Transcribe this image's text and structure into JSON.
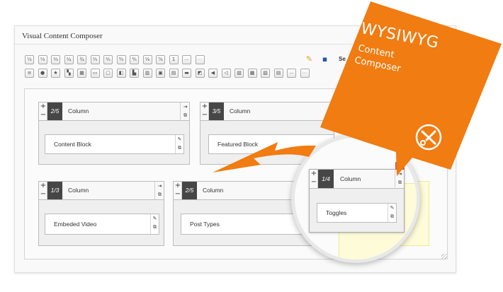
{
  "panel": {
    "title": "Visual Content Composer"
  },
  "toolbar": {
    "row1_icons": [
      "column-1-2-icon",
      "column-1-3-icon",
      "column-2-3-icon",
      "column-1-4-icon",
      "column-3-4-icon",
      "column-1-5-icon",
      "column-2-5-icon",
      "column-3-5-icon",
      "column-4-5-icon",
      "column-1-6-icon",
      "column-5-6-icon",
      "column-full-icon",
      "dash-icon",
      "dots-icon"
    ],
    "row1_glyphs": [
      "½",
      "⅓",
      "⅔",
      "¼",
      "¾",
      "⅕",
      "⅖",
      "⅗",
      "⅘",
      "⅙",
      "⅚",
      "1",
      "—",
      "⋯"
    ],
    "row2_icons": [
      "list-icon",
      "circle-icon",
      "star-icon",
      "layers-icon",
      "image-block-icon",
      "table-icon",
      "window-icon",
      "split-icon",
      "chart-icon",
      "building-icon",
      "photo-icon",
      "slider-icon",
      "monitor-icon",
      "video-icon",
      "audio-icon",
      "audio-play-icon",
      "gallery-icon",
      "grid-icon",
      "contact-form-icon",
      "form-icon",
      "dash-icon",
      "dots-icon"
    ],
    "row2_glyphs": [
      "≡",
      "●",
      "★",
      "▚",
      "▦",
      "▭",
      "▢",
      "◧",
      "▙",
      "▥",
      "▣",
      "▤",
      "▬",
      "◩",
      "◀",
      "◁",
      "▧",
      "▩",
      "▨",
      "▤",
      "—",
      "⋯"
    ],
    "save_label": "Se",
    "clean_glyph": "✎",
    "save_glyph": "▪"
  },
  "columns": [
    {
      "size": "2/5",
      "title": "Column",
      "block": "Content Block"
    },
    {
      "size": "3/5",
      "title": "Column",
      "block": "Featured Block"
    },
    {
      "size": "1/3",
      "title": "Column",
      "block": "Embeded Video"
    },
    {
      "size": "2/5",
      "title": "Column",
      "block": "Post Types"
    }
  ],
  "zoomed_column": {
    "size": "1/4",
    "title": "Column",
    "block": "Toggles",
    "close": "×"
  },
  "glyphs": {
    "plus": "+",
    "minus": "−",
    "expand": "⇥",
    "copy": "⧉",
    "edit": "✎"
  },
  "banner": {
    "title": "WYSIWYG",
    "line1": "Content",
    "line2": "Composer",
    "icon": "wrench-screwdriver-icon",
    "color": "#f07c12",
    "arrow_color": "#f07c12"
  }
}
